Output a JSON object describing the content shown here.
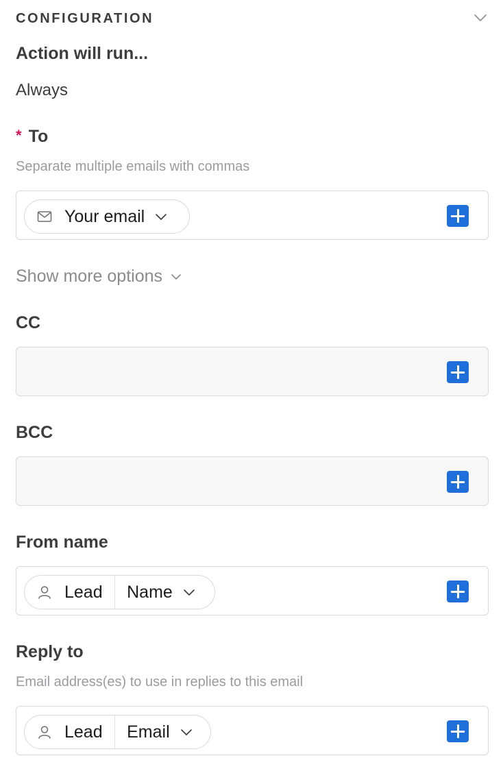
{
  "section": {
    "title": "CONFIGURATION",
    "collapse_icon": "chevron-down-icon"
  },
  "run_condition": {
    "label": "Action will run...",
    "value": "Always"
  },
  "to_field": {
    "required_marker": "*",
    "label": "To",
    "hint": "Separate multiple emails with commas",
    "chip": {
      "icon": "envelope-icon",
      "label": "Your email",
      "dropdown_icon": "chevron-down-icon"
    },
    "add_icon": "plus-icon"
  },
  "more_options": {
    "label": "Show more options",
    "icon": "chevron-down-icon"
  },
  "cc_field": {
    "label": "CC",
    "add_icon": "plus-icon"
  },
  "bcc_field": {
    "label": "BCC",
    "add_icon": "plus-icon"
  },
  "from_name_field": {
    "label": "From name",
    "chip": {
      "icon": "person-icon",
      "source": "Lead",
      "property": "Name",
      "dropdown_icon": "chevron-down-icon"
    },
    "add_icon": "plus-icon"
  },
  "reply_to_field": {
    "label": "Reply to",
    "hint": "Email address(es) to use in replies to this email",
    "chip": {
      "icon": "person-icon",
      "source": "Lead",
      "property": "Email",
      "dropdown_icon": "chevron-down-icon"
    },
    "add_icon": "plus-icon"
  },
  "colors": {
    "accent": "#1f6fdb",
    "required": "#d3145a",
    "border": "#d9d9dc",
    "hint_text": "#9a9aa0"
  }
}
